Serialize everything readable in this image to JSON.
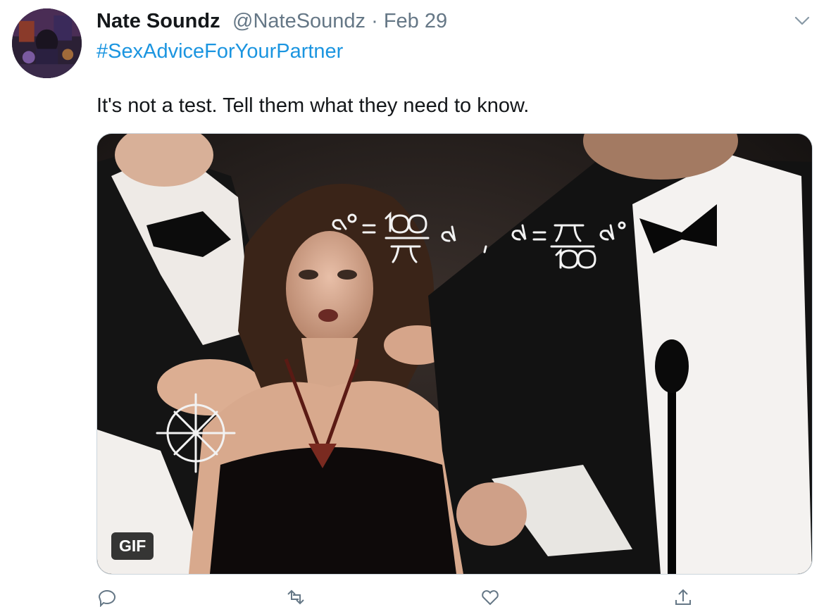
{
  "author": {
    "display_name": "Nate Soundz",
    "handle_and_date": "@NateSoundz · Feb 29",
    "avatar_icon": "profile-avatar"
  },
  "tweet": {
    "hashtag": "#SexAdviceForYourPartner",
    "text": "It's not a test. Tell them what they need to know.",
    "menu_icon": "chevron-down-icon"
  },
  "media": {
    "type": "gif",
    "badge": "GIF",
    "overlay_formula": "α° = 180/π α ; α = π/180 α°"
  },
  "actions": {
    "icons": [
      "reply-icon",
      "retweet-icon",
      "like-icon",
      "share-icon"
    ]
  },
  "colors": {
    "text": "#14171a",
    "secondary": "#657786",
    "link": "#1b95e0",
    "border": "#ccd6dd"
  }
}
